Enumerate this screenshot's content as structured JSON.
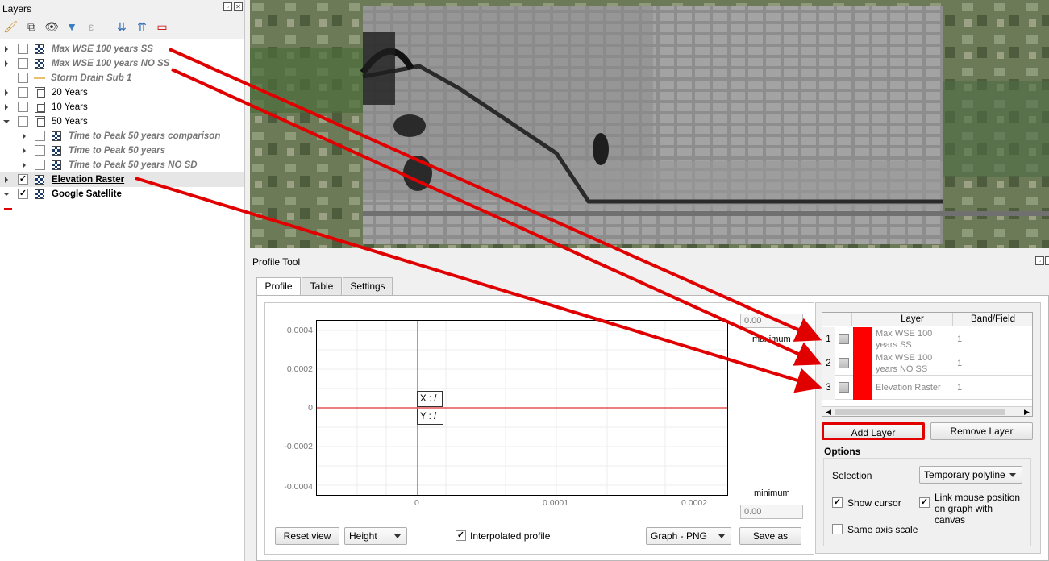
{
  "layers_panel": {
    "title": "Layers",
    "items": [
      {
        "label": "Max WSE 100 years SS",
        "checked": false,
        "style": "italic"
      },
      {
        "label": "Max WSE 100 years NO SS",
        "checked": false,
        "style": "italic"
      },
      {
        "label": "Storm Drain Sub 1",
        "checked": false,
        "style": "italic"
      },
      {
        "label": "20 Years",
        "checked": false,
        "style": "normal"
      },
      {
        "label": "10 Years",
        "checked": false,
        "style": "normal"
      },
      {
        "label": "50 Years",
        "checked": false,
        "style": "normal"
      },
      {
        "label": "Time to Peak 50 years comparison",
        "checked": false,
        "style": "italic"
      },
      {
        "label": "Time to Peak 50 years",
        "checked": false,
        "style": "italic"
      },
      {
        "label": "Time to Peak 50 years NO SD",
        "checked": false,
        "style": "italic"
      },
      {
        "label": "Elevation Raster",
        "checked": true,
        "style": "bold"
      },
      {
        "label": "Google Satellite",
        "checked": true,
        "style": "bold"
      }
    ]
  },
  "profile_tool": {
    "title": "Profile Tool",
    "tabs": [
      "Profile",
      "Table",
      "Settings"
    ],
    "y_ticks": [
      "0.0004",
      "0.0002",
      "0",
      "-0.0002",
      "-0.0004"
    ],
    "x_ticks": [
      "0",
      "0.0001",
      "0.0002"
    ],
    "cursor_x": "X : /",
    "cursor_y": "Y : /",
    "max_value": "0.00",
    "max_label": "maximum",
    "min_value": "0.00",
    "min_label": "minimum",
    "reset_view": "Reset view",
    "mode": "Height",
    "interpolated_label": "Interpolated profile",
    "interpolated_checked": true,
    "export_format": "Graph - PNG",
    "save_as": "Save as"
  },
  "layer_table": {
    "headers": [
      "Layer",
      "Band/Field"
    ],
    "rows": [
      {
        "num": "1",
        "name": "Max WSE 100 years SS",
        "band": "1",
        "color": "#ff0000"
      },
      {
        "num": "2",
        "name": "Max WSE 100 years NO SS",
        "band": "1",
        "color": "#ff0000"
      },
      {
        "num": "3",
        "name": "Elevation Raster",
        "band": "1",
        "color": "#ff0000"
      }
    ],
    "add_layer": "Add Layer",
    "remove_layer": "Remove Layer"
  },
  "options": {
    "title": "Options",
    "selection_label": "Selection",
    "selection_value": "Temporary polyline",
    "show_cursor": "Show cursor",
    "link_mouse": "Link mouse position on graph with canvas",
    "same_axis": "Same axis scale"
  },
  "colors": {
    "annotation": "#e00000",
    "accent_red": "#ff0000"
  }
}
